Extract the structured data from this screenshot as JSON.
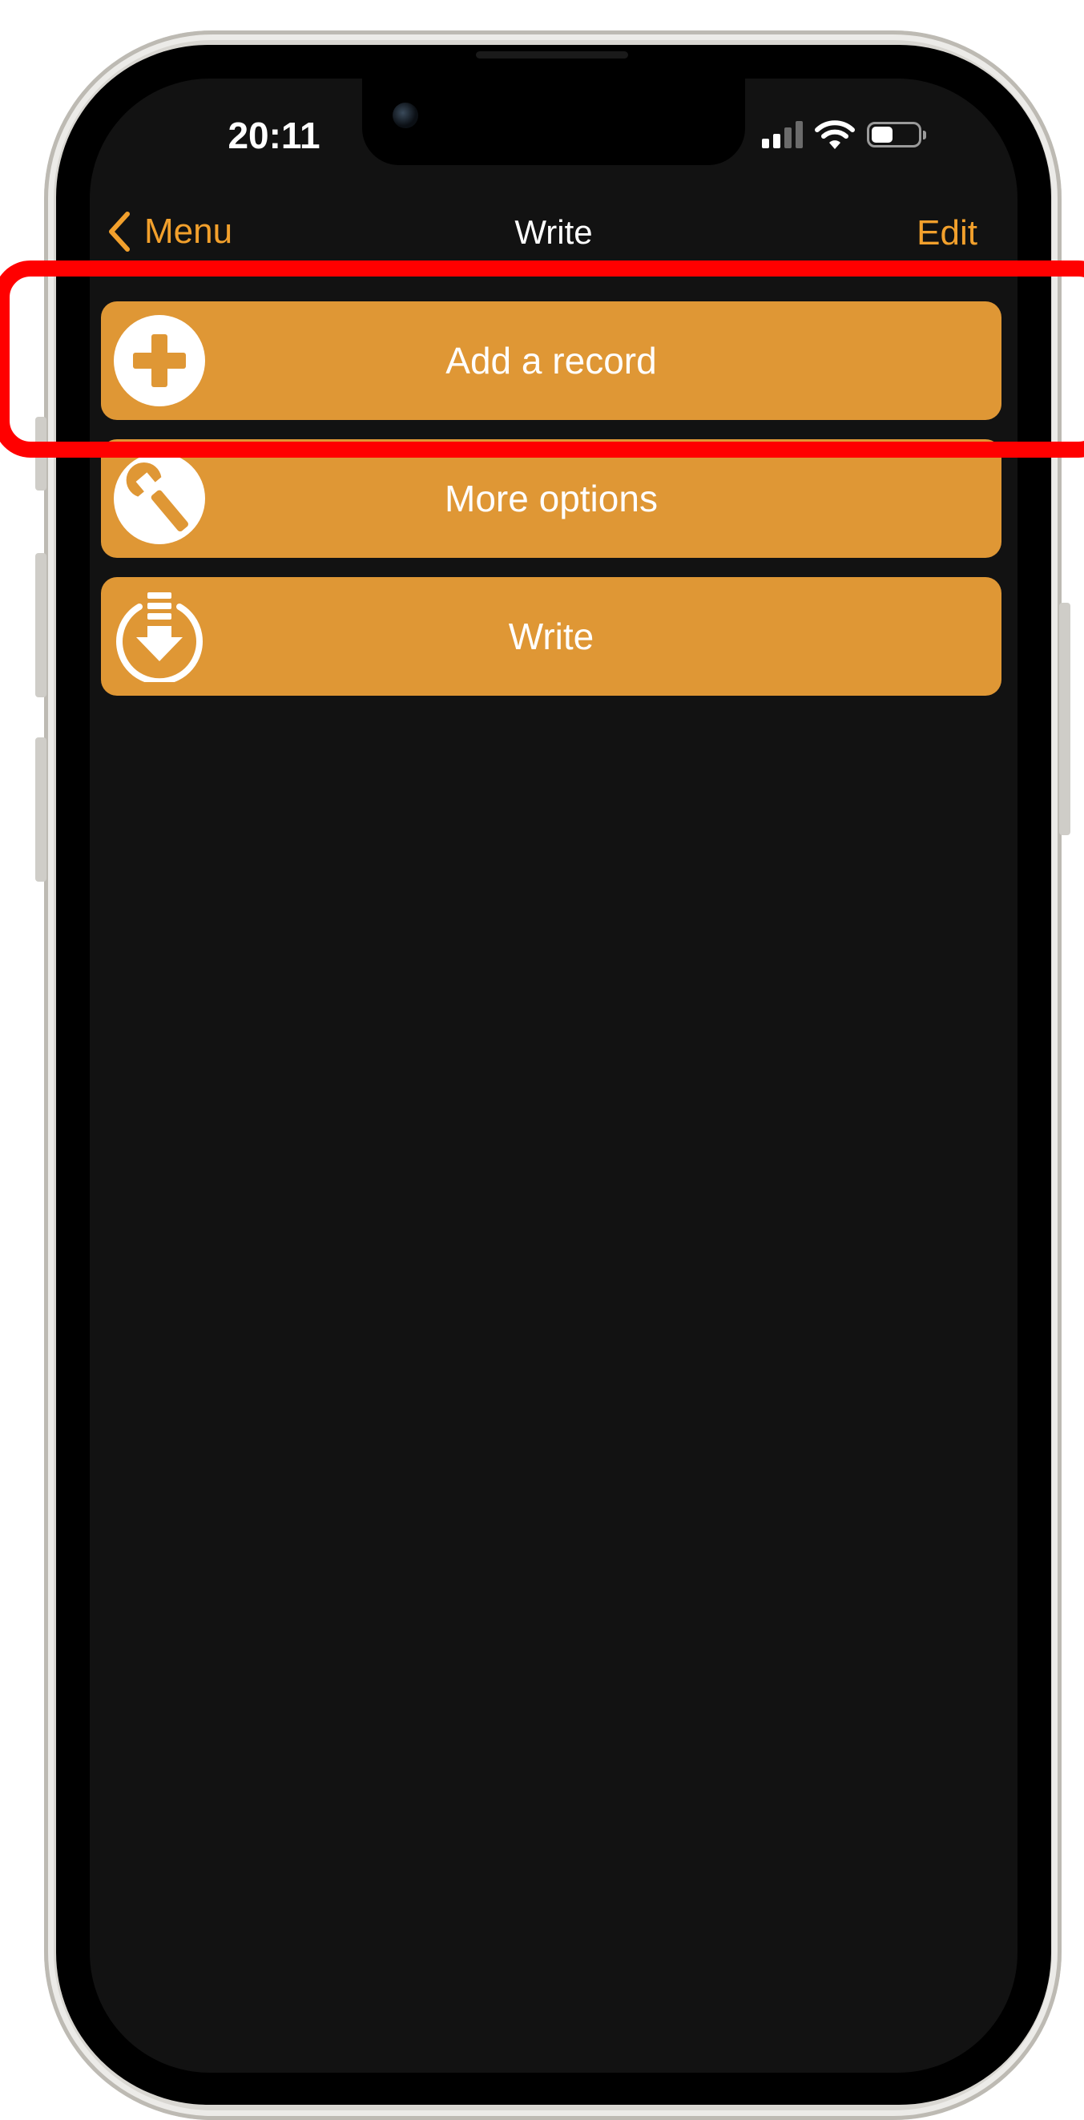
{
  "status_bar": {
    "time": "20:11"
  },
  "nav": {
    "back_label": "Menu",
    "title": "Write",
    "edit_label": "Edit"
  },
  "actions": [
    {
      "label": "Add a record",
      "icon": "plus-circle-icon"
    },
    {
      "label": "More options",
      "icon": "wrench-circle-icon"
    },
    {
      "label": "Write",
      "icon": "download-circle-icon"
    }
  ],
  "colors": {
    "accent": "#f2a02c",
    "button_bg": "#df9735",
    "screen_bg": "#121212",
    "highlight": "#ff0000"
  }
}
